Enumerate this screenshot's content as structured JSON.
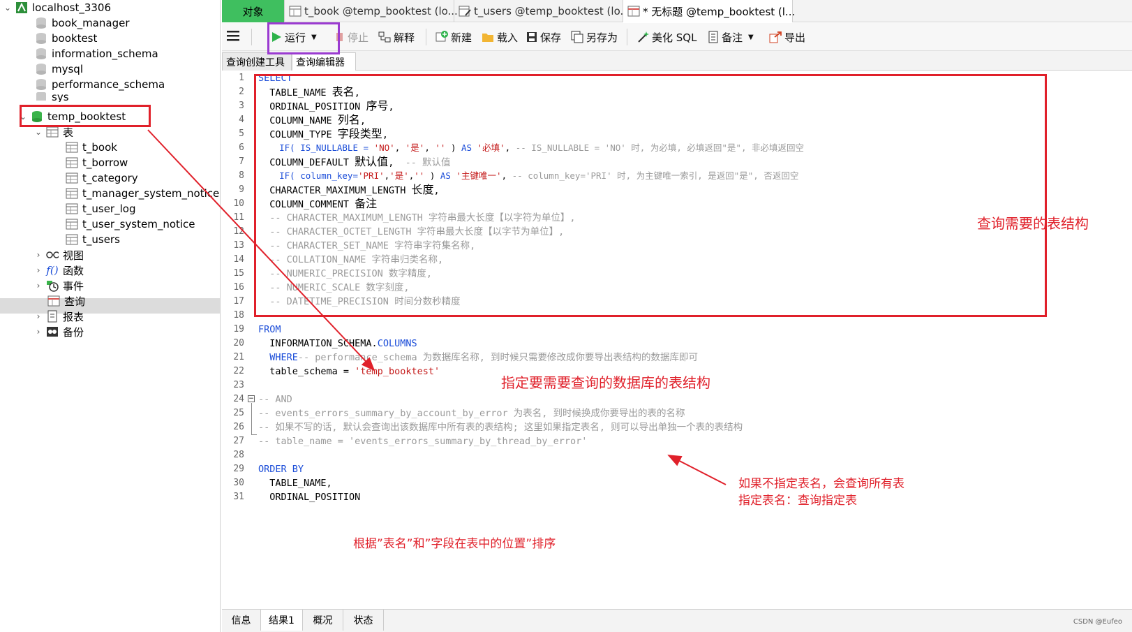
{
  "sidebar": {
    "connection": "localhost_3306",
    "databases": [
      "book_manager",
      "booktest",
      "information_schema",
      "mysql",
      "performance_schema",
      "sys",
      "temp_booktest"
    ],
    "tables_label": "表",
    "tables": [
      "t_book",
      "t_borrow",
      "t_category",
      "t_manager_system_notice",
      "t_user_log",
      "t_user_system_notice",
      "t_users"
    ],
    "groups": {
      "views": "视图",
      "functions": "函数",
      "events": "事件",
      "queries": "查询",
      "reports": "报表",
      "backups": "备份"
    }
  },
  "tabs": {
    "objects": "对象",
    "t1": "t_book @temp_booktest (lo...",
    "t2": "t_users @temp_booktest (lo...",
    "t3": "* 无标题 @temp_booktest (l..."
  },
  "toolbar": {
    "run": "运行",
    "stop": "停止",
    "explain": "解释",
    "new": "新建",
    "load": "载入",
    "save": "保存",
    "save_as": "另存为",
    "beautify": "美化 SQL",
    "notes": "备注",
    "export": "导出"
  },
  "subtabs": {
    "builder": "查询创建工具",
    "editor": "查询编辑器"
  },
  "code": {
    "l1": "SELECT",
    "l2_a": "  TABLE_NAME ",
    "l2_b": "表名",
    "l2_c": ",",
    "l3_a": "  ORDINAL_POSITION ",
    "l3_b": "序号",
    "l3_c": ",",
    "l4_a": "  COLUMN_NAME ",
    "l4_b": "列名",
    "l4_c": ",",
    "l5_a": "  COLUMN_TYPE ",
    "l5_b": "字段类型",
    "l5_c": ",",
    "l6_a": "    IF( IS_NULLABLE = ",
    "l6_b": "'NO'",
    "l6_c": ", ",
    "l6_d": "'是'",
    "l6_e": ", ",
    "l6_f": "''",
    "l6_g": " ) ",
    "l6_h": "AS",
    "l6_i": " ",
    "l6_j": "'必填'",
    "l6_k": ", ",
    "l6_l": "-- IS_NULLABLE = 'NO' 时, 为必填, 必填返回\"是\", 非必填返回空",
    "l7_a": "  COLUMN_DEFAULT ",
    "l7_b": "默认值",
    "l7_c": ",  ",
    "l7_d": "-- 默认值",
    "l8_a": "    IF( column_key=",
    "l8_b": "'PRI'",
    "l8_c": ",",
    "l8_d": "'是'",
    "l8_e": ",",
    "l8_f": "''",
    "l8_g": " ) ",
    "l8_h": "AS",
    "l8_i": " ",
    "l8_j": "'主键唯一'",
    "l8_k": ", ",
    "l8_l": "-- column_key='PRI' 时, 为主键唯一索引, 是返回\"是\", 否返回空",
    "l9_a": "  CHARACTER_MAXIMUM_LENGTH ",
    "l9_b": "长度",
    "l9_c": ",",
    "l10_a": "  COLUMN_COMMENT ",
    "l10_b": "备注",
    "l11": "  -- CHARACTER_MAXIMUM_LENGTH 字符串最大长度【以字符为单位】,",
    "l12": "  -- CHARACTER_OCTET_LENGTH 字符串最大长度【以字节为单位】,",
    "l13": "  -- CHARACTER_SET_NAME 字符串字符集名称,",
    "l14": "  -- COLLATION_NAME 字符串归类名称,",
    "l15": "  -- NUMERIC_PRECISION 数字精度,",
    "l16": "  -- NUMERIC_SCALE 数字刻度,",
    "l17": "  -- DATETIME_PRECISION 时间分数秒精度",
    "l19": "FROM",
    "l20_a": "  INFORMATION_SCHEMA.",
    "l20_b": "COLUMNS",
    "l21_a": "  WHERE",
    "l21_b": "-- performance_schema 为数据库名称, 到时候只需要修改成你要导出表结构的数据库即可",
    "l22_a": "  table_schema = ",
    "l22_b": "'temp_booktest'",
    "l24": "-- AND",
    "l25": "-- events_errors_summary_by_account_by_error 为表名, 到时候换成你要导出的表的名称",
    "l26": "-- 如果不写的话, 默认会查询出该数据库中所有表的表结构; 这里如果指定表名, 则可以导出单独一个表的表结构",
    "l27": "-- table_name = 'events_errors_summary_by_thread_by_error'",
    "l29": "ORDER BY",
    "l30": "  TABLE_NAME,",
    "l31": "  ORDINAL_POSITION"
  },
  "bottom_tabs": {
    "info": "信息",
    "result1": "结果1",
    "profile": "概况",
    "status": "状态"
  },
  "watermark": "CSDN @Eufeo",
  "annotations": {
    "a1": "查询需要的表结构",
    "a2": "指定要需要查询的数据库的表结构",
    "a3_1": "如果不指定表名，会查询所有表",
    "a3_2": "指定表名：查询指定表",
    "a4": "根据”表名”和”字段在表中的位置”排序"
  },
  "colors": {
    "annotation_red": "#e0202a",
    "run_highlight": "#9b3bd1",
    "objects_tab": "#3fbf5f",
    "keyword": "#1a4cd8",
    "string": "#c41a1a",
    "comment": "#9a9a9a"
  }
}
